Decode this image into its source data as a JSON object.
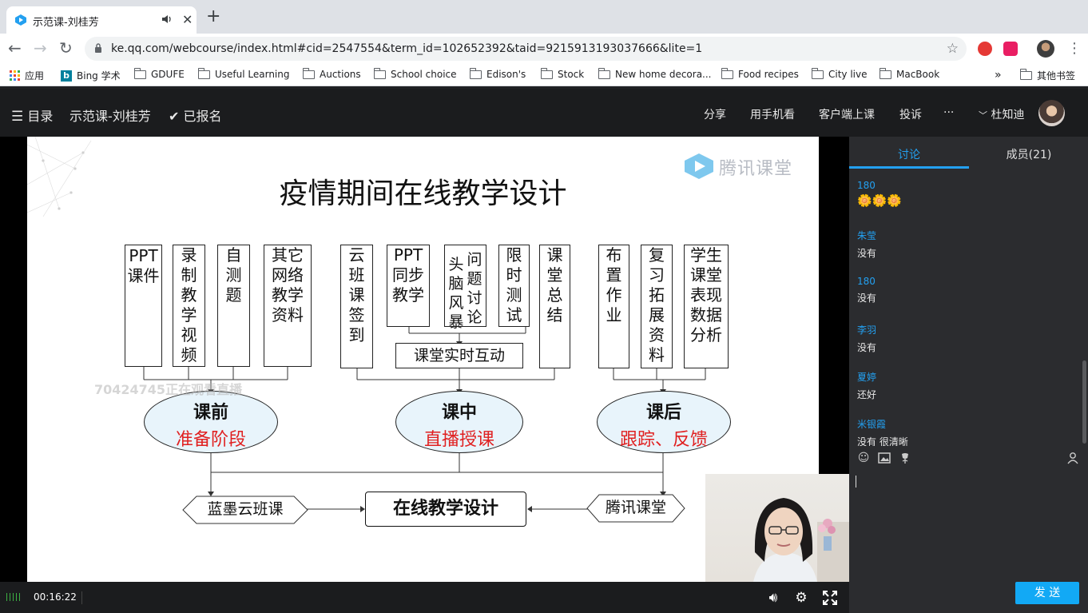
{
  "browser": {
    "tab_title": "示范课-刘桂芳",
    "url": "ke.qq.com/webcourse/index.html#cid=2547554&term_id=102652392&taid=9215913193037666&lite=1",
    "bookmarks": [
      "应用",
      "Bing 学术",
      "GDUFE",
      "Useful Learning",
      "Auctions",
      "School choice",
      "Edison's",
      "Stock",
      "New home decora...",
      "Food recipes",
      "City live",
      "MacBook"
    ],
    "bookmarks_more": "»",
    "other_bookmarks": "其他书签"
  },
  "header": {
    "menu_label": "目录",
    "course_title": "示范课-刘桂芳",
    "enrolled_label": "已报名",
    "actions": [
      "分享",
      "用手机看",
      "客户端上课",
      "投诉",
      "···"
    ],
    "user_name": "杜知迪"
  },
  "slide": {
    "brand": "腾讯课堂",
    "title": "疫情期间在线教学设计",
    "pre_items": [
      "PPT课件",
      "录制教学视频",
      "自测题",
      "其它网络教学资料"
    ],
    "mid_items": [
      "云班课签到",
      "PPT同步教学",
      "头脑风暴",
      "问题讨论",
      "限时测试",
      "课堂总结"
    ],
    "mid_sub": "课堂实时互动",
    "post_items": [
      "布置作业",
      "复习拓展资料",
      "学生课堂表现数据分析"
    ],
    "phases": [
      {
        "title": "课前",
        "subtitle": "准备阶段"
      },
      {
        "title": "课中",
        "subtitle": "直播授课"
      },
      {
        "title": "课后",
        "subtitle": "跟踪、反馈"
      }
    ],
    "left_platform": "蓝墨云班课",
    "center": "在线教学设计",
    "right_platform": "腾讯课堂",
    "watermark": "70424745正在观看直播"
  },
  "player": {
    "elapsed": "00:16:22"
  },
  "sidepanel": {
    "tabs": [
      "讨论",
      "成员(21)"
    ],
    "messages": [
      {
        "user": "180",
        "text": "🌼🌼🌼"
      },
      {
        "user": "朱莹",
        "text": "没有"
      },
      {
        "user": "180",
        "text": "没有"
      },
      {
        "user": "李羽",
        "text": "没有"
      },
      {
        "user": "夏婷",
        "text": "还好"
      },
      {
        "user": "米银霞",
        "text": "没有 很清晰"
      }
    ],
    "send_label": "发 送"
  },
  "colors": {
    "accent": "#23a0f0",
    "send_button": "#12a9f5",
    "phase_subtitle": "#e02020"
  }
}
